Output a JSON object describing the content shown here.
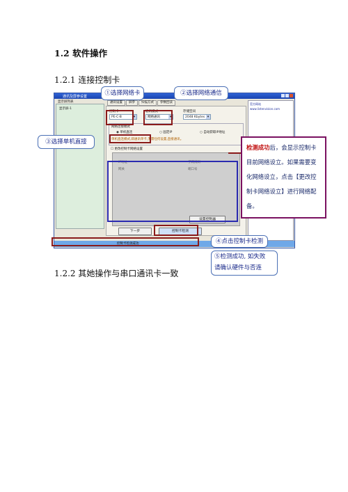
{
  "doc": {
    "section_title": "1.2  软件操作",
    "sub1_title": "1.2.1  连接控制卡",
    "sub2_title": "1.2.2  其她操作与串口通讯卡一致"
  },
  "shot": {
    "window_title": "通讯及屏参设置",
    "tree_label": "显示屏列表",
    "tree_node": "显示屏-1",
    "tabs": [
      "通讯设置",
      "屏参",
      "扫描方式",
      "参数回读"
    ],
    "card_label": "控制卡",
    "card_value": "PE-C-B",
    "comm_label": "通讯模式",
    "comm_value": "网络通讯",
    "storage_label": "存储空间",
    "storage_value": "2048 Kbytes",
    "net_mode_label": "网络连接模式",
    "radio_direct": "单机直连",
    "radio_fixed": "固定IP",
    "radio_auto": "自动获取IP地址",
    "hint": "单机直连模式,即通讯单卡,无需任何设置,直接通讯。",
    "checkbox": "更改控制卡网络设置",
    "ip_label": "IP地址",
    "mask_label": "子网掩码",
    "gateway_label": "网关",
    "port_label": "端口号",
    "next_button": "下一步",
    "detect_button": "控制卡检测",
    "set_button": "设置控制器",
    "status_text": "控制卡检测成功",
    "info_title": "官方网站",
    "info_url": "www.listenvision.com"
  },
  "annotations": {
    "c1": "①选择网络卡",
    "c2": "②选择网络通信",
    "c3": "③选择单机直接",
    "c4": "④点击控制卡检测",
    "c5_line1": "⑤检测成功, 如失败",
    "c5_line2": "请确认硬件与否连",
    "big_bold": "检测成功",
    "big_rest": "后，会显示控制卡目前网络设立。如果需要变化网络设立，点击【更改控制卡网络设立】进行网络配备。"
  }
}
